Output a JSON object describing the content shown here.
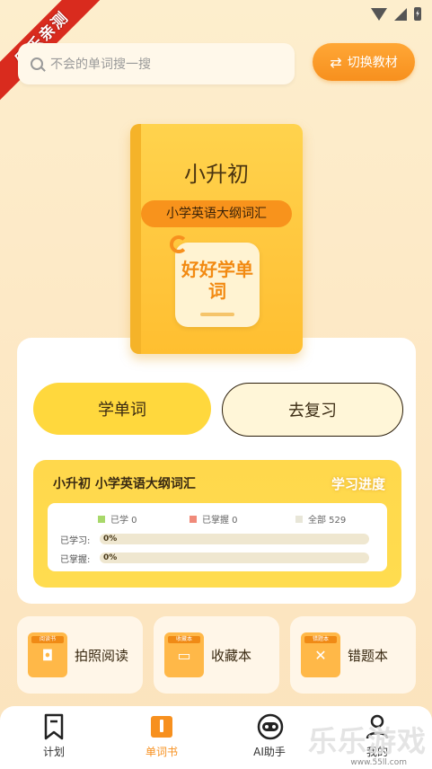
{
  "ribbon": {
    "text": "乐乐亲测"
  },
  "search": {
    "placeholder": "不会的单词搜一搜"
  },
  "header": {
    "switch_label": "切换教材"
  },
  "book": {
    "title": "小升初",
    "subtitle": "小学英语大纲词汇",
    "logo_text": "好好学单词"
  },
  "actions": {
    "learn_label": "学单词",
    "review_label": "去复习"
  },
  "progress": {
    "title": "小升初 小学英语大纲词汇",
    "tag": "学习进度",
    "legend": [
      {
        "label": "已学 0",
        "color": "#a8d86a"
      },
      {
        "label": "已掌握 0",
        "color": "#f08a7a"
      },
      {
        "label": "全部 529",
        "color": "#e8e6d8"
      }
    ],
    "bars": [
      {
        "label": "已学习:",
        "percent": "0%",
        "fraction": 0
      },
      {
        "label": "已掌握:",
        "percent": "0%",
        "fraction": 0
      }
    ]
  },
  "tools": [
    {
      "label": "拍照阅读",
      "icon_tag": "阅读书",
      "icon": "camera-icon"
    },
    {
      "label": "收藏本",
      "icon_tag": "收藏本",
      "icon": "bookmark-icon"
    },
    {
      "label": "错题本",
      "icon_tag": "错题本",
      "icon": "wrong-book-icon"
    }
  ],
  "tabs": [
    {
      "label": "计划",
      "icon": "bookmark-icon",
      "active": false
    },
    {
      "label": "单词书",
      "icon": "book-icon",
      "active": true
    },
    {
      "label": "AI助手",
      "icon": "robot-icon",
      "active": false
    },
    {
      "label": "我的",
      "icon": "user-icon",
      "active": false
    }
  ],
  "watermark": {
    "text": "乐乐游戏",
    "url": "www.55ll.com"
  },
  "colors": {
    "accent": "#f7901e",
    "yellow": "#ffd83d",
    "background": "#fdeecd"
  }
}
